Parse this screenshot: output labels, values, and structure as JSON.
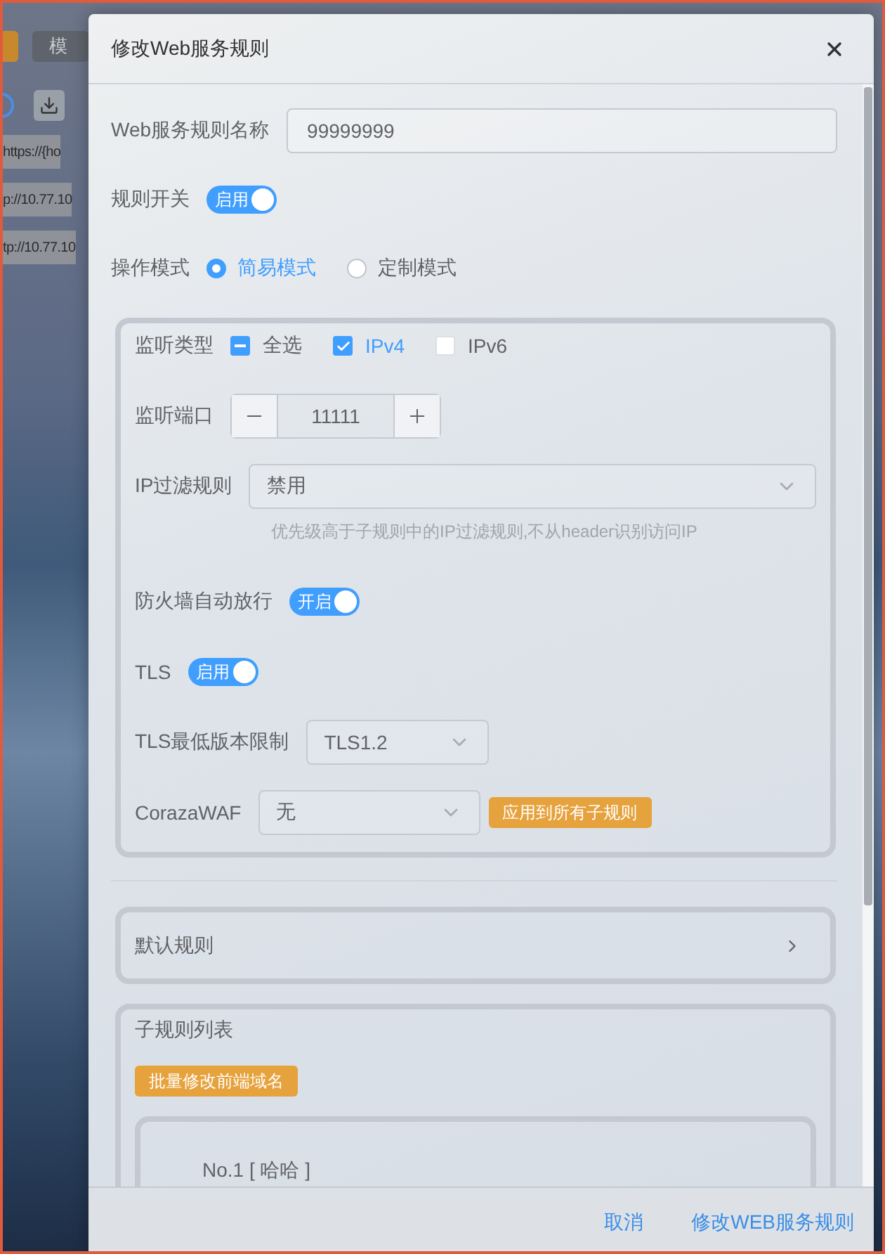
{
  "background": {
    "tab_label": "模",
    "urls": [
      "https://{ho",
      "p://10.77.10",
      "tp://10.77.10"
    ]
  },
  "dialog": {
    "title": "修改Web服务规则",
    "name_field": {
      "label": "Web服务规则名称",
      "value": "99999999"
    },
    "rule_switch": {
      "label": "规则开关",
      "text": "启用",
      "on": true
    },
    "mode": {
      "label": "操作模式",
      "options": [
        {
          "label": "简易模式",
          "selected": true
        },
        {
          "label": "定制模式",
          "selected": false
        }
      ]
    },
    "listen_type": {
      "label": "监听类型",
      "options": [
        {
          "label": "全选",
          "checked": false,
          "indeterminate": true
        },
        {
          "label": "IPv4",
          "checked": true,
          "indeterminate": false
        },
        {
          "label": "IPv6",
          "checked": false,
          "indeterminate": false
        }
      ]
    },
    "port": {
      "label": "监听端口",
      "value": "11111"
    },
    "ip_filter": {
      "label": "IP过滤规则",
      "value": "禁用",
      "hint": "优先级高于子规则中的IP过滤规则,不从header识别访问IP"
    },
    "firewall": {
      "label": "防火墙自动放行",
      "text": "开启",
      "on": true
    },
    "tls": {
      "label": "TLS",
      "text": "启用",
      "on": true
    },
    "tls_min": {
      "label": "TLS最低版本限制",
      "value": "TLS1.2"
    },
    "waf": {
      "label": "CorazaWAF",
      "value": "无",
      "button": "应用到所有子规则"
    },
    "default_rule": {
      "label": "默认规则",
      "expanded": false
    },
    "sub_rules": {
      "title": "子规则列表",
      "batch_button": "批量修改前端域名",
      "items": [
        {
          "title": "No.1 [ 哈哈 ]"
        }
      ]
    },
    "footer": {
      "cancel": "取消",
      "confirm": "修改WEB服务规则"
    }
  }
}
